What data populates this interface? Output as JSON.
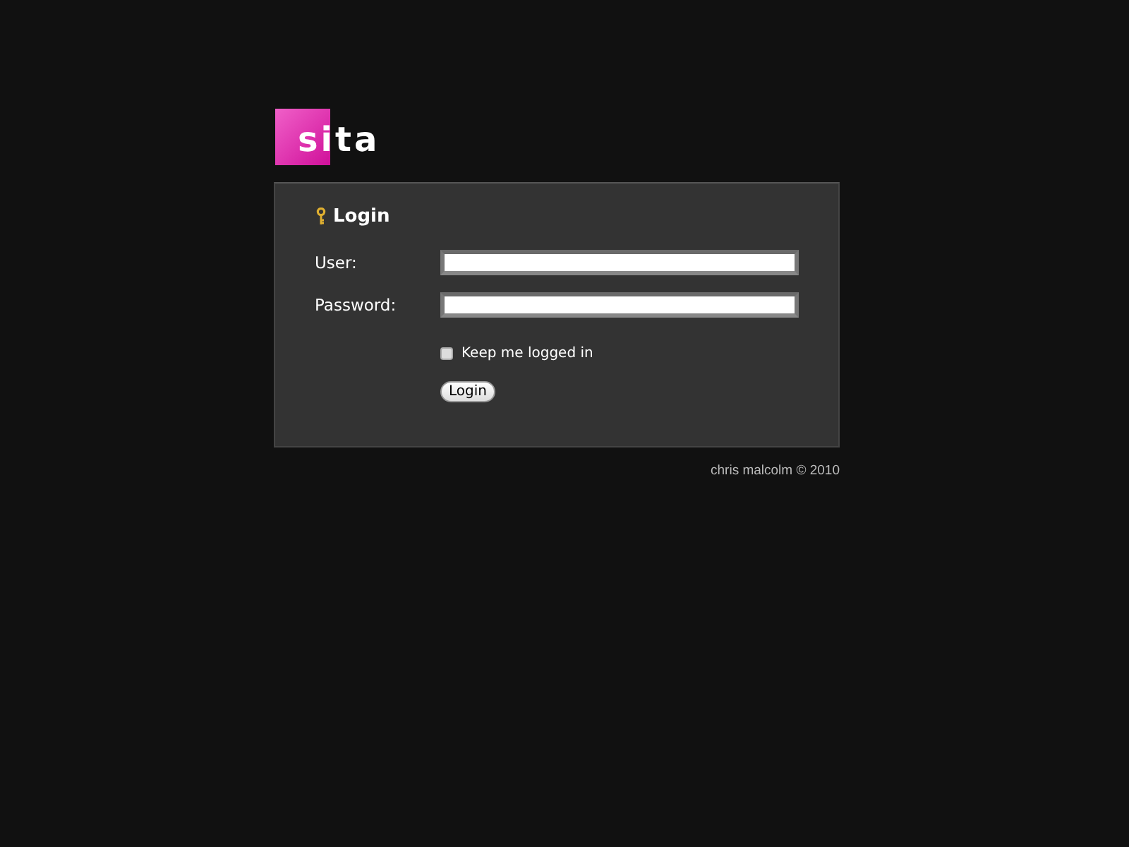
{
  "logo": "sita",
  "login": {
    "title": "Login",
    "fields": [
      {
        "label": "User:"
      },
      {
        "label": "Password:"
      }
    ],
    "remember": {
      "label": "Keep me logged in",
      "checked": false
    },
    "button": "Login"
  },
  "footer": "chris malcolm © 2010"
}
